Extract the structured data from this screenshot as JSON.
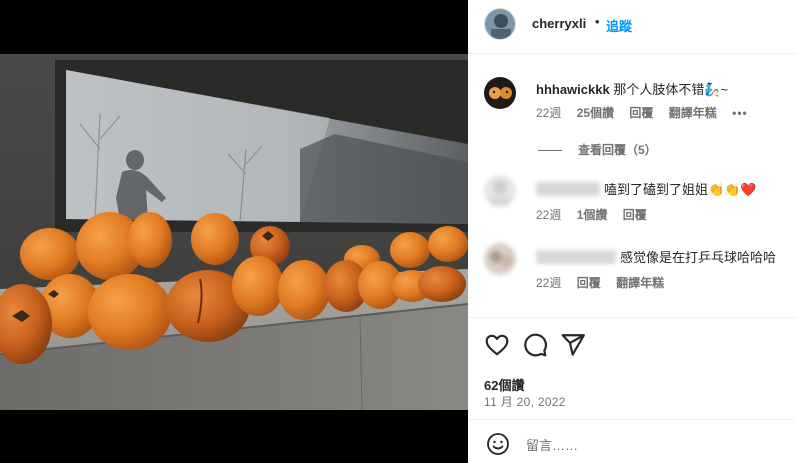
{
  "post": {
    "username": "cherryxli",
    "separator": "•",
    "follow_label": "追蹤"
  },
  "comments": [
    {
      "username": "hhhawickkk",
      "text": "那个人肢体不错🧞~",
      "meta": {
        "time": "22週",
        "likes": "25個讚",
        "reply": "回覆",
        "translate": "翻譯年糕"
      },
      "more_icon": "ellipsis-icon",
      "view_replies": "查看回覆（5）"
    },
    {
      "username_blurred": true,
      "text": "嗑到了磕到了姐姐👏👏❤️",
      "meta": {
        "time": "22週",
        "likes": "1個讚",
        "reply": "回覆"
      }
    },
    {
      "username_blurred": true,
      "text": "感觉像是在打乒乓球哈哈哈",
      "meta": {
        "time": "22週",
        "reply": "回覆",
        "translate": "翻譯年糕"
      }
    }
  ],
  "actions": {
    "like_icon": "heart-icon",
    "comment_icon": "comment-icon",
    "share_icon": "share-icon"
  },
  "likes_count": "62個讚",
  "date": "11 月 20, 2022",
  "compose": {
    "emoji_icon": "smiley-icon",
    "placeholder": "留言……"
  },
  "colors": {
    "link_blue": "#0095f6",
    "text": "#262626",
    "secondary": "#737373",
    "heart_red": "#ed4956"
  }
}
